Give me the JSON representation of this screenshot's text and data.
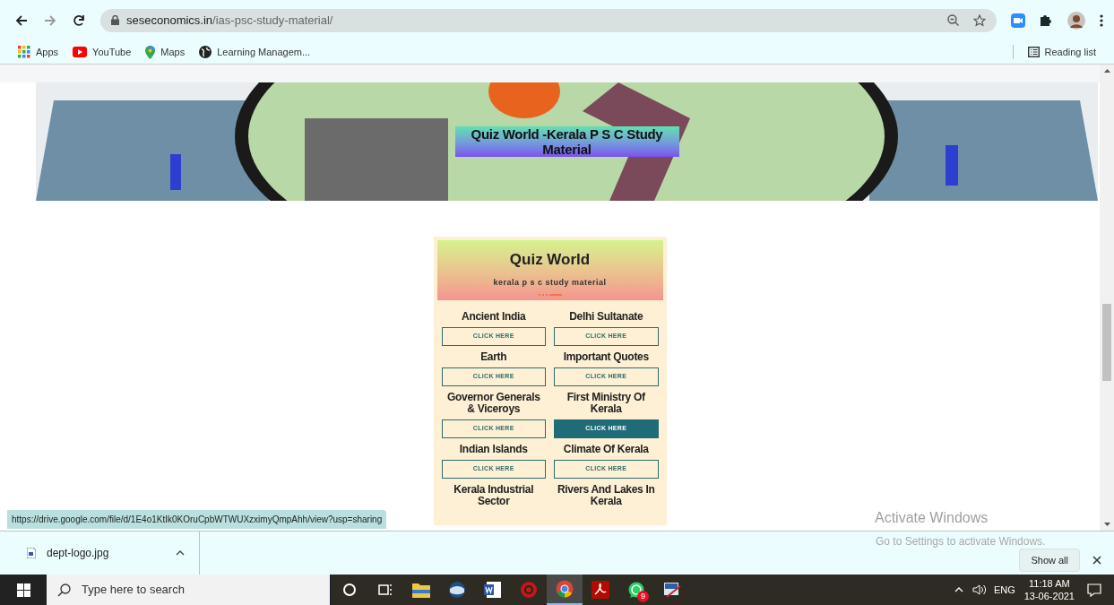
{
  "browser": {
    "url_host": "seseconomics.in",
    "url_path": "/ias-psc-study-material/",
    "bookmarks": [
      {
        "label": "Apps",
        "kind": "apps"
      },
      {
        "label": "YouTube",
        "kind": "youtube"
      },
      {
        "label": "Maps",
        "kind": "maps"
      },
      {
        "label": "Learning Managem...",
        "kind": "globe"
      }
    ],
    "reading_list": "Reading list"
  },
  "banner": {
    "caption": "Quiz World -Kerala P S C Study Material"
  },
  "card": {
    "title": "Quiz World",
    "subtitle": "kerala p s c study material",
    "topics": [
      {
        "title": "Ancient India",
        "button": "CLICK HERE",
        "highlighted": false
      },
      {
        "title": "Delhi Sultanate",
        "button": "CLICK HERE",
        "highlighted": false
      },
      {
        "title": "Earth",
        "button": "CLICK HERE",
        "highlighted": false
      },
      {
        "title": "Important Quotes",
        "button": "CLICK HERE",
        "highlighted": false
      },
      {
        "title": "Governor Generals & Viceroys",
        "button": "CLICK HERE",
        "highlighted": false
      },
      {
        "title": "First Ministry Of Kerala",
        "button": "CLICK HERE",
        "highlighted": true
      },
      {
        "title": "Indian Islands",
        "button": "CLICK HERE",
        "highlighted": false
      },
      {
        "title": "Climate Of Kerala",
        "button": "CLICK HERE",
        "highlighted": false
      },
      {
        "title": "Kerala Industrial Sector"
      },
      {
        "title": "Rivers And Lakes In Kerala"
      }
    ]
  },
  "status_url": "https://drive.google.com/file/d/1E4o1KtIk0KOruCpbWTWUXzximyQmpAhh/view?usp=sharing",
  "downloads": {
    "file": "dept-logo.jpg",
    "show_all": "Show all"
  },
  "activation": {
    "title": "Activate Windows",
    "subtitle": "Go to Settings to activate Windows."
  },
  "taskbar": {
    "search_placeholder": "Type here to search",
    "apps": [
      {
        "kind": "cortana",
        "active": false
      },
      {
        "kind": "taskview",
        "active": false
      },
      {
        "kind": "folder",
        "active": false
      },
      {
        "kind": "globe",
        "active": false
      },
      {
        "kind": "word",
        "active": false
      },
      {
        "kind": "redapp",
        "active": false
      },
      {
        "kind": "chrome",
        "active": true
      },
      {
        "kind": "acrobat",
        "active": false
      },
      {
        "kind": "whatsapp",
        "active": false,
        "badge": "9"
      },
      {
        "kind": "tool",
        "active": false
      }
    ],
    "language": "ENG",
    "time": "11:18 AM",
    "date": "13-06-2021"
  }
}
